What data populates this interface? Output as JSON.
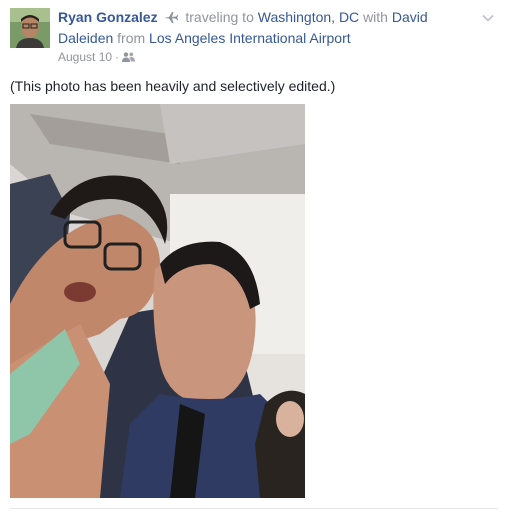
{
  "post": {
    "author": "Ryan Gonzalez",
    "activity": "traveling to",
    "destination": "Washington, DC",
    "with_text": "with",
    "tagged": "David Daleiden",
    "from_text": "from",
    "origin": "Los Angeles International Airport",
    "date": "August 10",
    "separator": "·",
    "audience_icon": "friends-icon",
    "activity_icon": "airplane-icon",
    "caption": "(This photo has been heavily and selectively edited.)",
    "menu_icon": "chevron-down-icon"
  },
  "colors": {
    "link": "#365899",
    "meta": "#90949c",
    "text": "#1d2129"
  }
}
